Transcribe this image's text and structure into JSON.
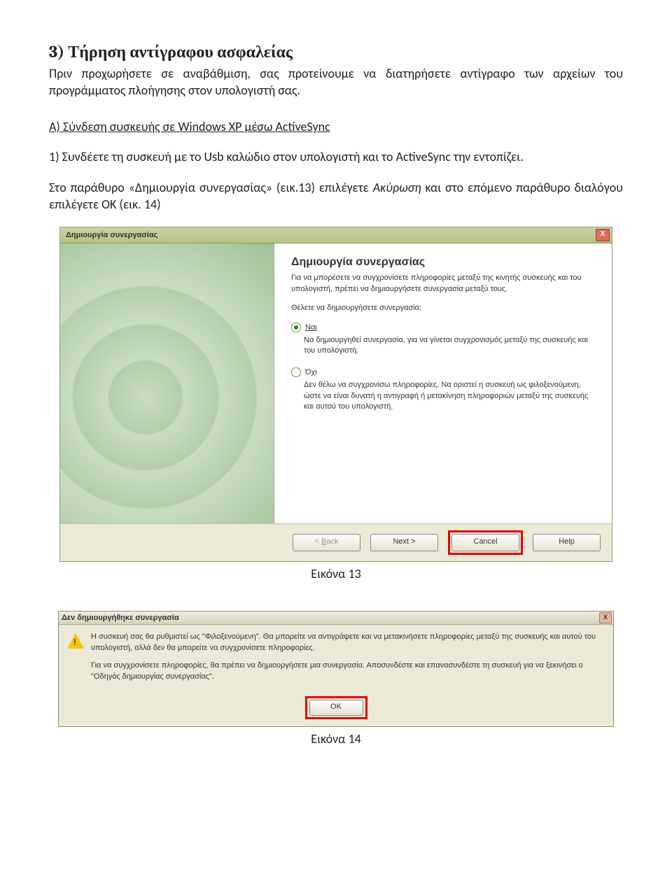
{
  "doc": {
    "heading": "3) Τήρηση αντίγραφου ασφαλείας",
    "para1": "Πριν προχωρήσετε σε αναβάθμιση, σας προτείνουμε να διατηρήσετε αντίγραφο των αρχείων του προγράμματος πλοήγησης στον υπολογιστή σας.",
    "subheading": "Α) Σύνδεση συσκευής σε Windows XP μέσω ActiveSync",
    "para2_pre": "1) Συνδέετε τη συσκευή με το Usb καλώδιο στον υπολογιστή και το ActiveSync την εντοπίζει.",
    "para3_a": "Στο παράθυρο «Δημιουργία συνεργασίας» (εικ.13) επιλέγετε ",
    "para3_italic": "Ακύρωση",
    "para3_b": " και στο επόμενο παράθυρο διαλόγου επιλέγετε ΟΚ (εικ. 14)",
    "caption1": "Εικόνα 13",
    "caption2": "Εικόνα 14"
  },
  "d1": {
    "title": "Δημιουργία συνεργασίας",
    "heading": "Δημιουργία συνεργασίας",
    "p1": "Για να μπορέσετε να συγχρονίσετε πληροφορίες μεταξύ της κινητής συσκευής και του υπολογιστή, πρέπει να δημιουργήσετε συνεργασία μεταξύ τους.",
    "p2": "Θέλετε να δημιουργήσετε συνεργασία;",
    "opt_yes": "Ναι",
    "opt_yes_desc": "Να δημιουργηθεί συνεργασία, για να γίνεται συγχρονισμός μεταξύ της συσκευής και του υπολογιστή.",
    "opt_no": "Όχι",
    "opt_no_desc": "Δεν θέλω να συγχρονίσω πληροφορίες. Να οριστεί η συσκευή ως φιλοξενούμενη, ώστε να είναι δυνατή η αντιγραφή ή μετακίνηση πληροφοριών μεταξύ της συσκευής και αυτού του υπολογιστή.",
    "btn_back": "< Back",
    "btn_next": "Next >",
    "btn_cancel": "Cancel",
    "btn_help": "Help"
  },
  "d2": {
    "title": "Δεν δημιουργήθηκε συνεργασία",
    "p1": "Η συσκευή σας θα ρυθμιστεί ως \"Φιλοξενούμενη\". Θα μπορείτε να αντιγράψετε και να μετακινήσετε πληροφορίες μεταξύ της συσκευής και αυτού του υπολογιστή, αλλά δεν θα μπορείτε να συγχρονίσετε πληροφορίες.",
    "p2": "Για να συγχρονίσετε πληροφορίες, θα πρέπει να δημιουργήσετε μια συνεργασία. Αποσυνδέστε και επανασυνδέστε τη συσκευή για να ξεκινήσει ο \"Οδηγός δημιουργίας συνεργασίας\".",
    "btn_ok": "OK"
  }
}
